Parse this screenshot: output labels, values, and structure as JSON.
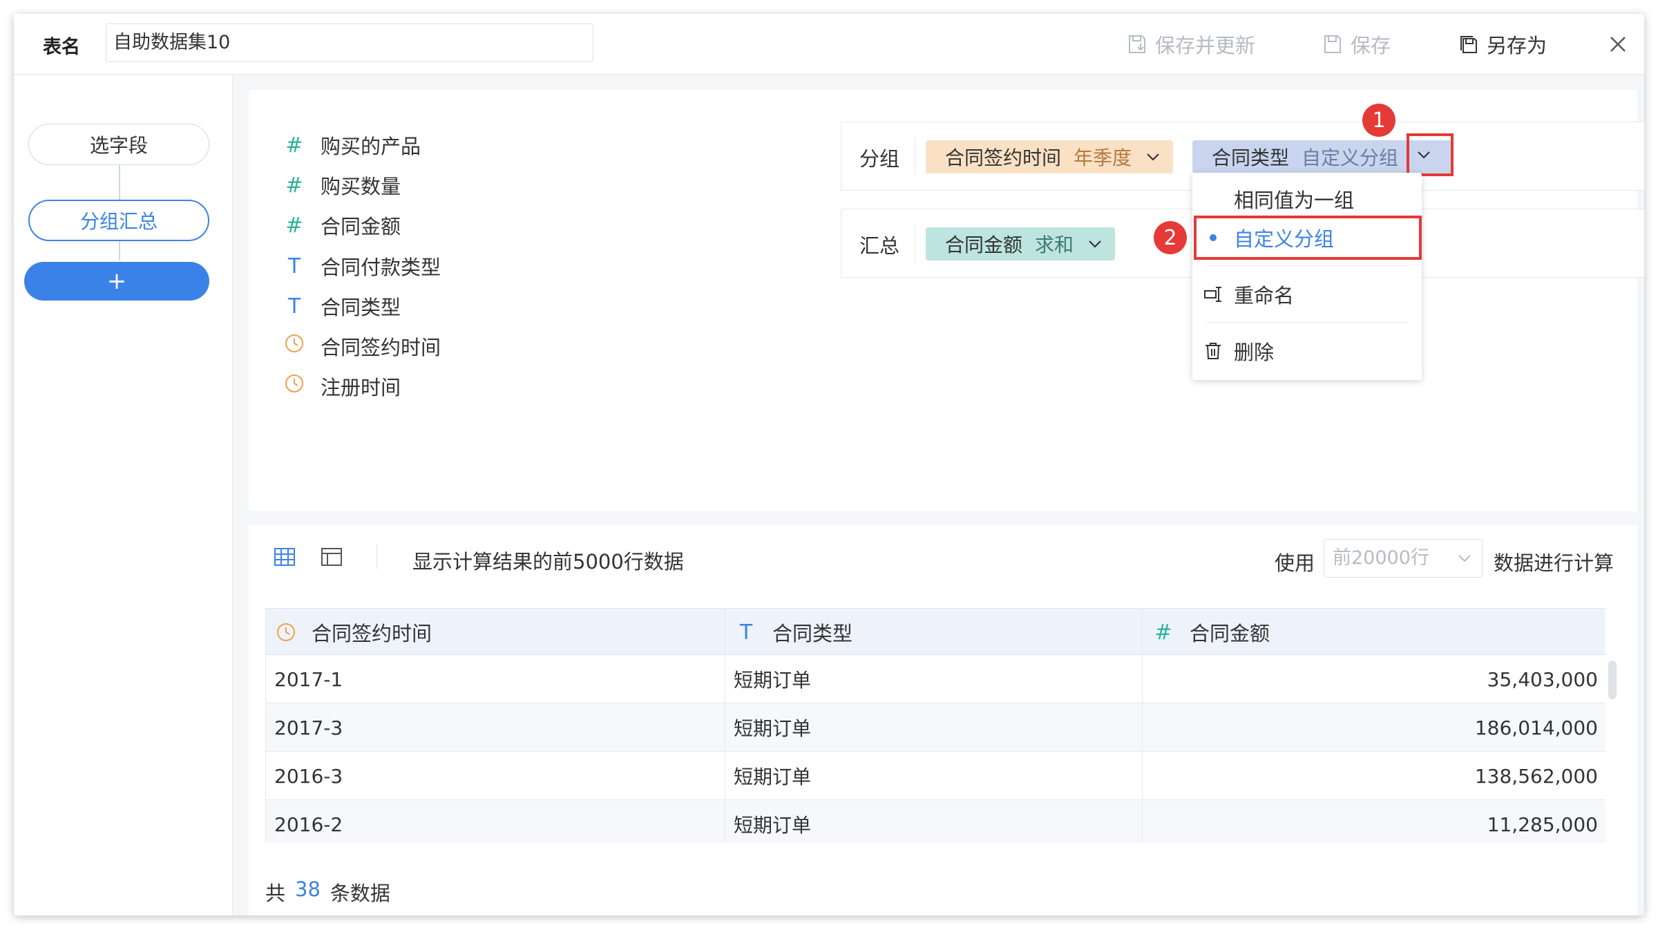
{
  "header": {
    "table_label": "表名",
    "table_name": "自助数据集10",
    "save_update_label": "保存并更新",
    "save_label": "保存",
    "save_as_label": "另存为"
  },
  "nav": {
    "step_select": "选字段",
    "step_group": "分组汇总",
    "add_label": "+"
  },
  "fields": [
    {
      "type": "number",
      "icon": "#",
      "name": "购买的产品"
    },
    {
      "type": "number",
      "icon": "#",
      "name": "购买数量"
    },
    {
      "type": "number",
      "icon": "#",
      "name": "合同金额"
    },
    {
      "type": "text",
      "icon": "T",
      "name": "合同付款类型"
    },
    {
      "type": "text",
      "icon": "T",
      "name": "合同类型"
    },
    {
      "type": "time",
      "icon": "clock",
      "name": "合同签约时间"
    },
    {
      "type": "time",
      "icon": "clock",
      "name": "注册时间"
    }
  ],
  "group_zone": {
    "label": "分组",
    "chips": [
      {
        "name": "合同签约时间",
        "sub": "年季度",
        "color": "#fbe1c4"
      },
      {
        "name": "合同类型",
        "sub": "自定义分组",
        "color": "#c9d5ee"
      }
    ]
  },
  "summary_zone": {
    "label": "汇总",
    "chips": [
      {
        "name": "合同金额",
        "sub": "求和",
        "color": "#bde4de"
      }
    ]
  },
  "dropdown_menu": {
    "items": [
      {
        "label": "相同值为一组",
        "selected": false
      },
      {
        "label": "自定义分组",
        "selected": true
      },
      {
        "label": "重命名",
        "icon": "rename-icon"
      },
      {
        "label": "删除",
        "icon": "trash-icon"
      }
    ]
  },
  "annotations": {
    "step1": "1",
    "step2": "2",
    "highlight_color": "#e53a37"
  },
  "preview": {
    "caption": "显示计算结果的前5000行数据",
    "use_label": "使用",
    "row_limit_placeholder": "前20000行",
    "after_label": "数据进行计算",
    "columns": [
      {
        "type": "time",
        "name": "合同签约时间"
      },
      {
        "type": "text",
        "name": "合同类型"
      },
      {
        "type": "number",
        "name": "合同金额"
      }
    ],
    "rows": [
      [
        "2017-1",
        "短期订单",
        "35,403,000"
      ],
      [
        "2017-3",
        "短期订单",
        "186,014,000"
      ],
      [
        "2016-3",
        "短期订单",
        "138,562,000"
      ],
      [
        "2016-2",
        "短期订单",
        "11,285,000"
      ]
    ],
    "total_prefix": "共",
    "total_count": "38",
    "total_suffix": "条数据"
  },
  "colors": {
    "accent": "#3b82e8",
    "number_icon": "#2ab39a"
  }
}
